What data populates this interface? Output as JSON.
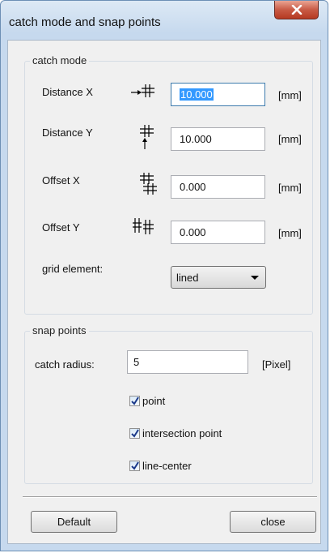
{
  "window": {
    "title": "catch mode and snap points",
    "close_glyph": "X"
  },
  "catch_mode": {
    "legend": "catch mode",
    "distance_x": {
      "label": "Distance X",
      "value": "10.000",
      "unit": "[mm]",
      "icon": "grid-arrow-x-icon"
    },
    "distance_y": {
      "label": "Distance Y",
      "value": "10.000",
      "unit": "[mm]",
      "icon": "grid-arrow-y-icon"
    },
    "offset_x": {
      "label": "Offset X",
      "value": "0.000",
      "unit": "[mm]",
      "icon": "grid-offset-x-icon"
    },
    "offset_y": {
      "label": "Offset Y",
      "value": "0.000",
      "unit": "[mm]",
      "icon": "grid-offset-y-icon"
    },
    "grid_element": {
      "label": "grid element:",
      "selected": "lined"
    }
  },
  "snap_points": {
    "legend": "snap points",
    "catch_radius": {
      "label": "catch radius:",
      "value": "5",
      "unit": "[Pixel]"
    },
    "options": [
      {
        "label": "point",
        "checked": true
      },
      {
        "label": "intersection point",
        "checked": true
      },
      {
        "label": "line-center",
        "checked": true
      }
    ]
  },
  "buttons": {
    "default_label": "Default",
    "close_label": "close"
  },
  "colors": {
    "titlebar": "#c6d9ee",
    "close_button": "#c85a45",
    "selection": "#3399ff"
  }
}
